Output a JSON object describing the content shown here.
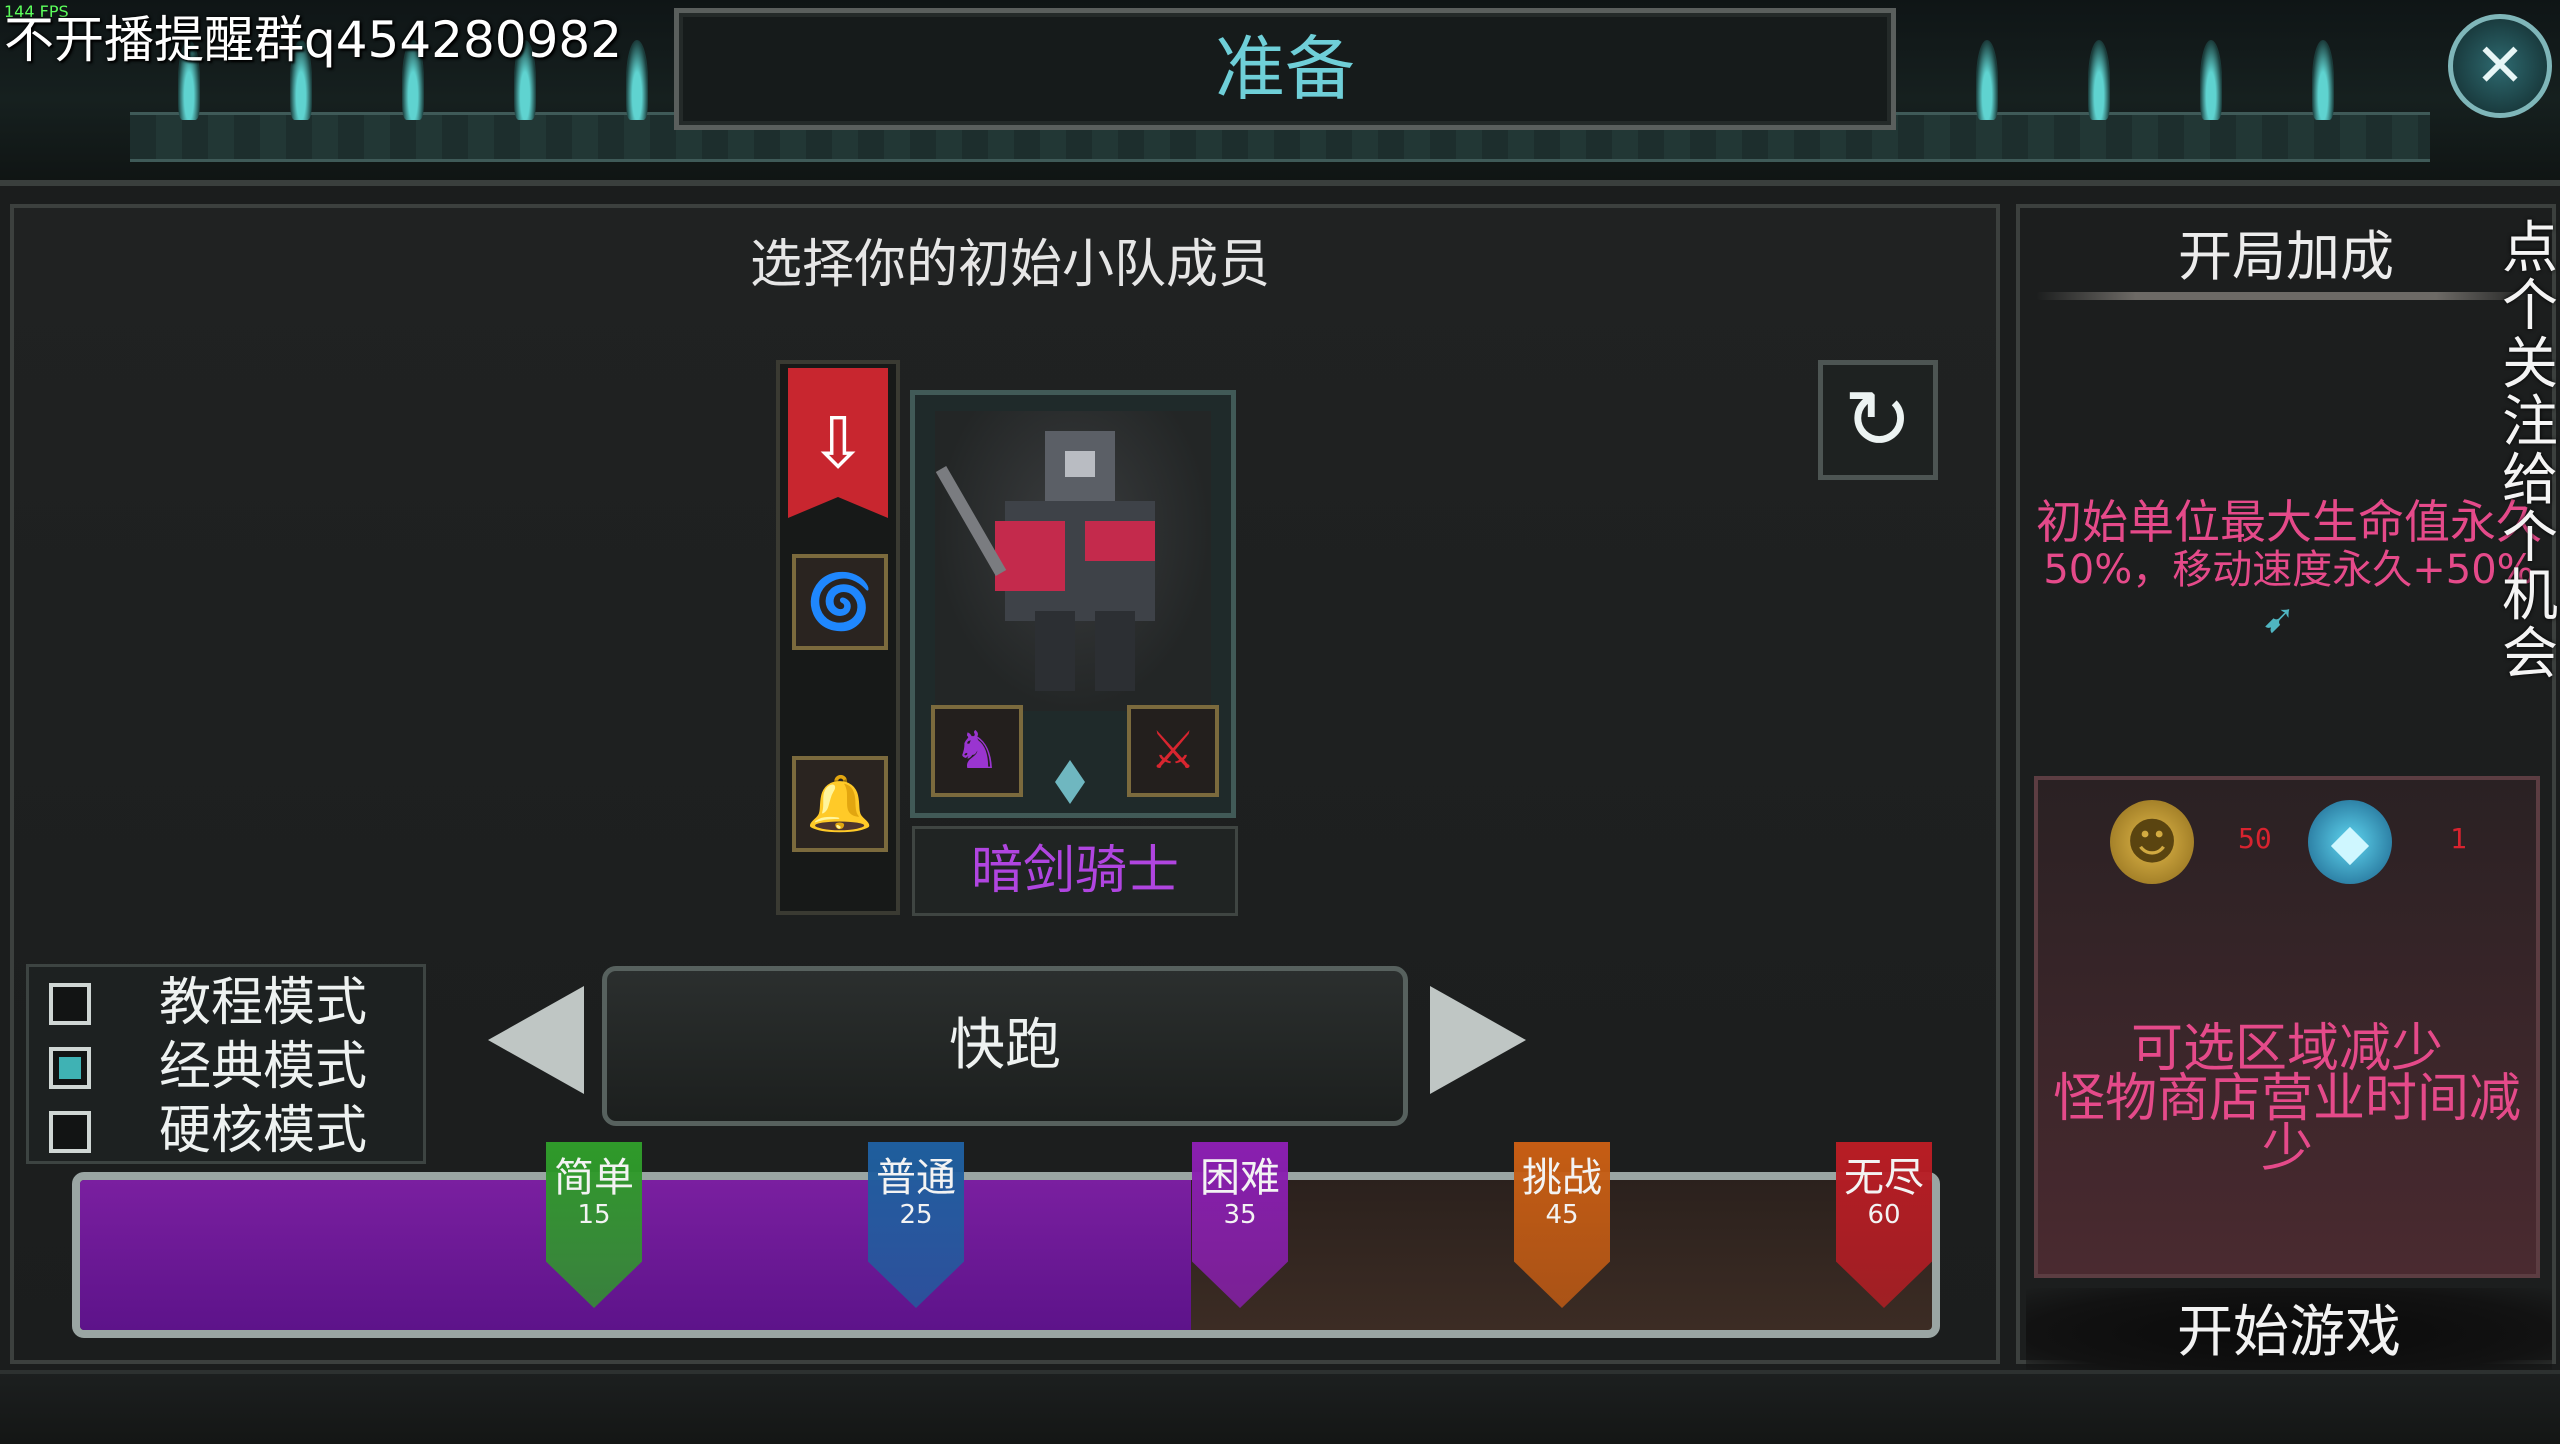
{
  "header": {
    "title": "准备",
    "close_icon": "close-icon"
  },
  "overlay": {
    "watermark": "不开播提醒群q454280982",
    "fps": "144 FPS",
    "follow_text": "点个关注，给个机会"
  },
  "squad": {
    "title": "选择你的初始小队成员",
    "character": {
      "name": "暗剑骑士",
      "name_color": "#b045e0"
    },
    "refresh_icon": "refresh-icon"
  },
  "modes": [
    {
      "label": "教程模式",
      "checked": false
    },
    {
      "label": "经典模式",
      "checked": true
    },
    {
      "label": "硬核模式",
      "checked": false
    }
  ],
  "speed": {
    "label": "快跑"
  },
  "difficulty": {
    "selected": "困难",
    "progress": 0.6,
    "levels": [
      {
        "name": "简单",
        "value": "15",
        "color": "#2f9a2a"
      },
      {
        "name": "普通",
        "value": "25",
        "color": "#1f5e9e"
      },
      {
        "name": "困难",
        "value": "35",
        "color": "#8a1fb0"
      },
      {
        "name": "挑战",
        "value": "45",
        "color": "#c65d14"
      },
      {
        "name": "无尽",
        "value": "60",
        "color": "#b81d24"
      }
    ]
  },
  "bonus": {
    "title": "开局加成",
    "text_line1": "初始单位最大生命值永久",
    "text_line2": "50%，移动速度永久+50%",
    "rewards": [
      {
        "icon": "gold-coin-icon",
        "value": "50"
      },
      {
        "icon": "diamond-icon",
        "value": "1"
      }
    ],
    "penalty_line1": "可选区域减少",
    "penalty_line2": "怪物商店营业时间减少"
  },
  "start_button": {
    "label": "开始游戏"
  },
  "colors": {
    "accent": "#6fcfd8",
    "bonus_text": "#e54a8a",
    "reward_value": "#d8232f"
  }
}
